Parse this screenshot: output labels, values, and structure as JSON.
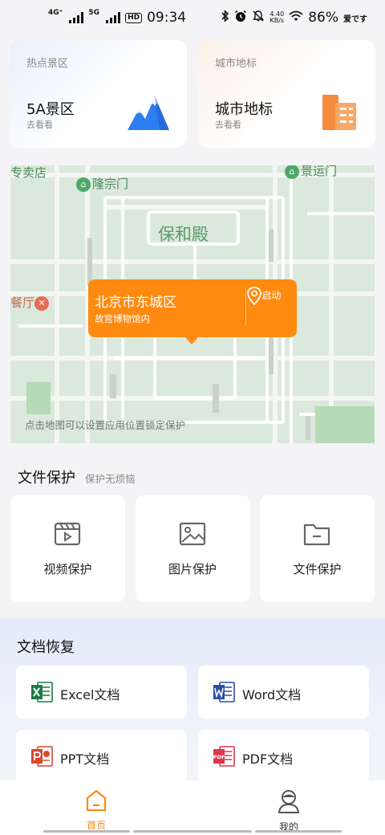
{
  "status_bar": {
    "net1": "4G⁺",
    "net2": "5G",
    "hd": "HD",
    "time": "09:34",
    "speed_top": "4.40",
    "speed_bottom": "KB/s",
    "battery": "86%",
    "carrier_label": "爱です"
  },
  "top_cards": [
    {
      "tag": "热点景区",
      "title": "5A景区",
      "sub": "去看看",
      "icon": "mountain-icon"
    },
    {
      "tag": "城市地标",
      "title": "城市地标",
      "sub": "去看看",
      "icon": "building-icon"
    }
  ],
  "map": {
    "labels": {
      "shop": "专卖店",
      "longzong": "隆宗门",
      "jingyun": "景运门",
      "baohe": "保和殿",
      "restaurant": "餐厅"
    },
    "tip": "点击地图可以设置应用位置锁定保护",
    "bubble": {
      "title": "北京市东城区",
      "subtitle": "故宫博物馆内",
      "button": "启动"
    }
  },
  "file_protect": {
    "title": "文件保护",
    "subtitle": "保护无烦恼",
    "items": [
      {
        "label": "视频保护",
        "icon": "video-icon"
      },
      {
        "label": "图片保护",
        "icon": "image-icon"
      },
      {
        "label": "文件保护",
        "icon": "folder-icon"
      }
    ]
  },
  "recover": {
    "title": "文档恢复",
    "items": [
      {
        "label": "Excel文档",
        "icon": "excel-icon"
      },
      {
        "label": "Word文档",
        "icon": "word-icon"
      },
      {
        "label": "PPT文档",
        "icon": "ppt-icon"
      },
      {
        "label": "PDF文档",
        "icon": "pdf-icon"
      }
    ]
  },
  "bottom_nav": [
    {
      "label": "首页",
      "icon": "home-icon",
      "active": true
    },
    {
      "label": "我的",
      "icon": "profile-icon",
      "active": false
    }
  ],
  "colors": {
    "accent": "#ff8a10",
    "background": "#f4f4f6",
    "map_bg": "#dbe8dc",
    "excel": "#1f7a44",
    "word": "#2b4fa6",
    "ppt": "#d8492e",
    "pdf": "#e0364a"
  }
}
